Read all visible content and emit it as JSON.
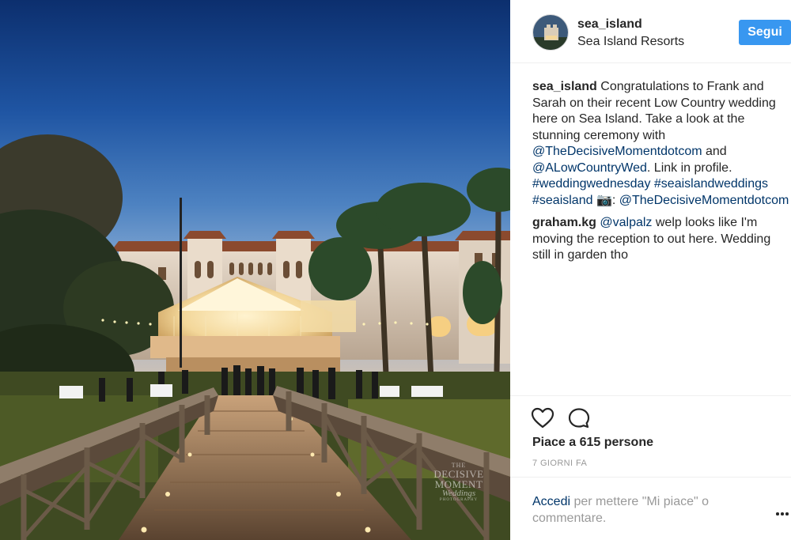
{
  "post": {
    "image": {
      "subject": "wedding-bridge-photo",
      "watermark": {
        "line1": "THE",
        "line2": "DECISIVE",
        "line3": "MOMENT",
        "line4": "Weddings",
        "line5": "PHOTOGRAPHY"
      }
    },
    "header": {
      "username": "sea_island",
      "location": "Sea Island Resorts",
      "follow_label": "Segui"
    },
    "caption": {
      "username": "sea_island",
      "text_1": "Congratulations to Frank and Sarah on their recent Low Country wedding here on Sea Island. Take a look at the stunning ceremony with ",
      "mention_1": "@TheDecisiveMomentdotcom",
      "text_2": " and ",
      "mention_2": "@ALowCountryWed",
      "text_3": ". Link in profile. ",
      "hashtag_1": "#weddingwednesday",
      "hashtag_2": "#seaislandweddings",
      "hashtag_3": "#seaisland",
      "camera_emoji": "📷",
      "text_4": ": ",
      "mention_3": "@TheDecisiveMomentdotcom"
    },
    "comments": [
      {
        "username": "graham.kg",
        "mention": "@valpalz",
        "text": " welp looks like I'm moving the reception to out here. Wedding still in garden tho"
      }
    ],
    "actions": {
      "like_icon": "heart-outline-icon",
      "comment_icon": "speech-bubble-icon"
    },
    "likes_text": "Piace a 615 persone",
    "timestamp": "7 GIORNI FA",
    "login_prompt": {
      "link": "Accedi",
      "text": " per mettere \"Mi piace\" o commentare."
    },
    "colors": {
      "follow_button": "#3897f0",
      "link": "#003569",
      "muted": "#999999"
    }
  }
}
